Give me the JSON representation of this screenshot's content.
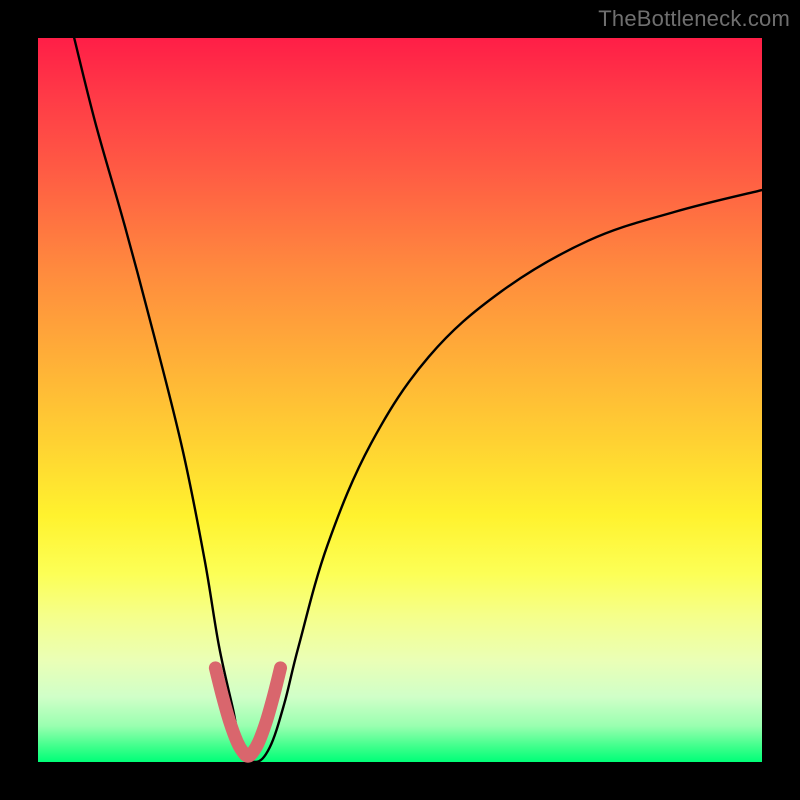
{
  "watermark": "TheBottleneck.com",
  "chart_data": {
    "type": "line",
    "title": "",
    "xlabel": "",
    "ylabel": "",
    "xlim": [
      0,
      100
    ],
    "ylim": [
      0,
      100
    ],
    "grid": false,
    "series": [
      {
        "name": "bottleneck-curve",
        "color": "#000000",
        "x": [
          5,
          8,
          12,
          16,
          20,
          23,
          25,
          27,
          28,
          30,
          32,
          34,
          36,
          40,
          46,
          54,
          64,
          76,
          88,
          100
        ],
        "y": [
          100,
          88,
          74,
          59,
          43,
          28,
          16,
          7,
          2,
          0,
          2,
          8,
          16,
          30,
          44,
          56,
          65,
          72,
          76,
          79
        ]
      },
      {
        "name": "highlight-segment",
        "color": "#d9666d",
        "x": [
          24.5,
          25.5,
          26.5,
          27.5,
          28.3,
          29.0,
          29.7,
          30.5,
          31.5,
          32.5,
          33.5
        ],
        "y": [
          13,
          9,
          5.5,
          2.8,
          1.4,
          0.8,
          1.4,
          2.8,
          5.5,
          9,
          13
        ]
      }
    ]
  }
}
